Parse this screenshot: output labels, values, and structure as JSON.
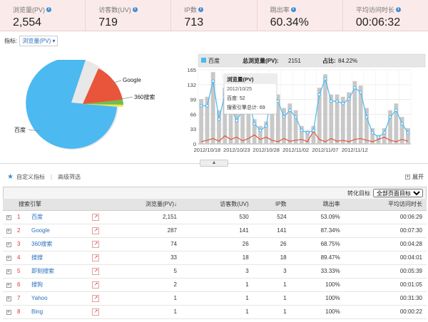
{
  "stats": [
    {
      "label": "浏览量(PV)",
      "value": "2,554"
    },
    {
      "label": "访客数(UV)",
      "value": "719"
    },
    {
      "label": "IP数",
      "value": "713"
    },
    {
      "label": "跳出率",
      "value": "60.34%"
    },
    {
      "label": "平均访问时长",
      "value": "00:06:32"
    }
  ],
  "metric": {
    "label": "指标:",
    "selected": "浏览量(PV)"
  },
  "pie": {
    "labels": [
      "Google",
      "360搜索",
      "百度"
    ],
    "colors": {
      "baidu": "#4cb9f0",
      "google": "#e8553a",
      "s360": "#6abf4b",
      "other": "#f2e14c"
    }
  },
  "tooltip": {
    "title": "浏览量(PV)",
    "date": "2012/10/25",
    "line1": "百度: 52",
    "line2": "搜索引擎总计: 69"
  },
  "chart_header": {
    "legend": "百度",
    "total_label": "总浏览量(PV):",
    "total_value": "2151",
    "ratio_label": "占比:",
    "ratio_value": "84.22%"
  },
  "chart_data": {
    "type": "line",
    "yticks": [
      "165",
      "132",
      "99",
      "66",
      "33",
      "0"
    ],
    "ylim": [
      0,
      165
    ],
    "x_labels": [
      "2012/10/18",
      "2012/10/23",
      "2012/10/28",
      "2012/11/02",
      "2012/11/07",
      "2012/11/12"
    ],
    "series": [
      {
        "name": "百度",
        "values": [
          85,
          85,
          140,
          55,
          110,
          80,
          52,
          75,
          100,
          45,
          30,
          40,
          120,
          95,
          60,
          75,
          60,
          30,
          25,
          30,
          110,
          145,
          95,
          95,
          90,
          100,
          125,
          115,
          60,
          25,
          15,
          25,
          60,
          75,
          45,
          25
        ]
      },
      {
        "values": [
          100,
          105,
          160,
          75,
          125,
          95,
          69,
          90,
          120,
          55,
          40,
          50,
          135,
          110,
          80,
          90,
          75,
          40,
          30,
          40,
          125,
          155,
          110,
          110,
          105,
          115,
          140,
          130,
          80,
          35,
          20,
          35,
          75,
          90,
          60,
          35
        ]
      },
      {
        "values": [
          5,
          8,
          12,
          6,
          18,
          10,
          15,
          7,
          12,
          20,
          10,
          15,
          8,
          5,
          12,
          6,
          8,
          10,
          5,
          28,
          10,
          5,
          12,
          6,
          8,
          5,
          10,
          12,
          8,
          5,
          10,
          15,
          8,
          5,
          10,
          6
        ]
      }
    ]
  },
  "custom": {
    "label": "自定义指标",
    "filter": "高级筛选",
    "expand": "展开"
  },
  "convert": {
    "label": "转化目标",
    "selected": "全部页面目标"
  },
  "table": {
    "headers": [
      "搜索引擎",
      "浏览量(PV)↓",
      "访客数(UV)",
      "IP数",
      "跳出率",
      "平均访问时长"
    ],
    "rows": [
      {
        "rank": "1",
        "name": "百度",
        "pv": "2,151",
        "uv": "530",
        "ip": "524",
        "bounce": "53.09%",
        "time": "00:06:29"
      },
      {
        "rank": "2",
        "name": "Google",
        "pv": "287",
        "uv": "141",
        "ip": "141",
        "bounce": "87.34%",
        "time": "00:07:30"
      },
      {
        "rank": "3",
        "name": "360搜索",
        "pv": "74",
        "uv": "26",
        "ip": "26",
        "bounce": "68.75%",
        "time": "00:04:28"
      },
      {
        "rank": "4",
        "name": "搜搜",
        "pv": "33",
        "uv": "18",
        "ip": "18",
        "bounce": "89.47%",
        "time": "00:04:01"
      },
      {
        "rank": "5",
        "name": "即刻搜索",
        "pv": "5",
        "uv": "3",
        "ip": "3",
        "bounce": "33.33%",
        "time": "00:05:39"
      },
      {
        "rank": "6",
        "name": "搜狗",
        "pv": "2",
        "uv": "1",
        "ip": "1",
        "bounce": "100%",
        "time": "00:01:05"
      },
      {
        "rank": "7",
        "name": "Yahoo",
        "pv": "1",
        "uv": "1",
        "ip": "1",
        "bounce": "100%",
        "time": "00:31:30"
      },
      {
        "rank": "8",
        "name": "Bing",
        "pv": "1",
        "uv": "1",
        "ip": "1",
        "bounce": "100%",
        "time": "00:00:22"
      }
    ]
  }
}
